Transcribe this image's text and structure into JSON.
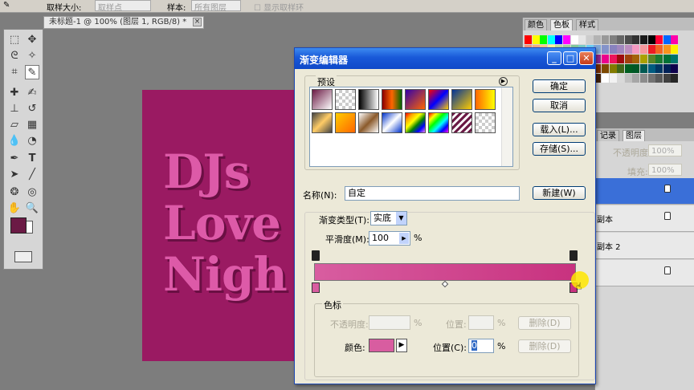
{
  "options_bar": {
    "sample_size_label": "取样大小:",
    "sample_size_value": "取样点",
    "sample_label": "样本:",
    "sample_value": "所有图层",
    "show_ring_label": "显示取样环"
  },
  "document": {
    "tab_title": "未标题-1 @ 100% (图层 1, RGB/8) *",
    "close_glyph": "×",
    "canvas_lines": [
      "DJs",
      "Love",
      "Nigh"
    ]
  },
  "panels": {
    "swatches_tabs": [
      "颜色",
      "色板",
      "样式"
    ],
    "layers_tabs": [
      "记录",
      "图层"
    ],
    "opacity_label": "不透明度:",
    "opacity_value": "100%",
    "fill_label": "填充:",
    "fill_value": "100%",
    "layer_rows": [
      "",
      "副本",
      "副本 2",
      ""
    ]
  },
  "dialog": {
    "title": "渐变编辑器",
    "presets_label": "预设",
    "ok": "确定",
    "cancel": "取消",
    "load": "载入(L)...",
    "save": "存储(S)...",
    "name_label": "名称(N):",
    "name_value": "自定",
    "new_button": "新建(W)",
    "gradient_type_label": "渐变类型(T):",
    "gradient_type_value": "实底",
    "smoothness_label": "平滑度(M):",
    "smoothness_value": "100",
    "percent": "%",
    "stops_group_label": "色标",
    "opacity_label": "不透明度:",
    "location_label": "位置:",
    "delete_label": "删除(D)",
    "color_label": "颜色:",
    "color_location_label": "位置(C):",
    "color_location_value": "0",
    "color_delete_label": "删除(D)"
  },
  "colors": {
    "canvas_bg": "#9a1a62",
    "text_pink": "#dd5aa8",
    "gradient_start": "#d85da0",
    "gradient_end": "#c8327f",
    "foreground_swatch": "#6b1a45",
    "xp_blue": "#1858d8"
  }
}
